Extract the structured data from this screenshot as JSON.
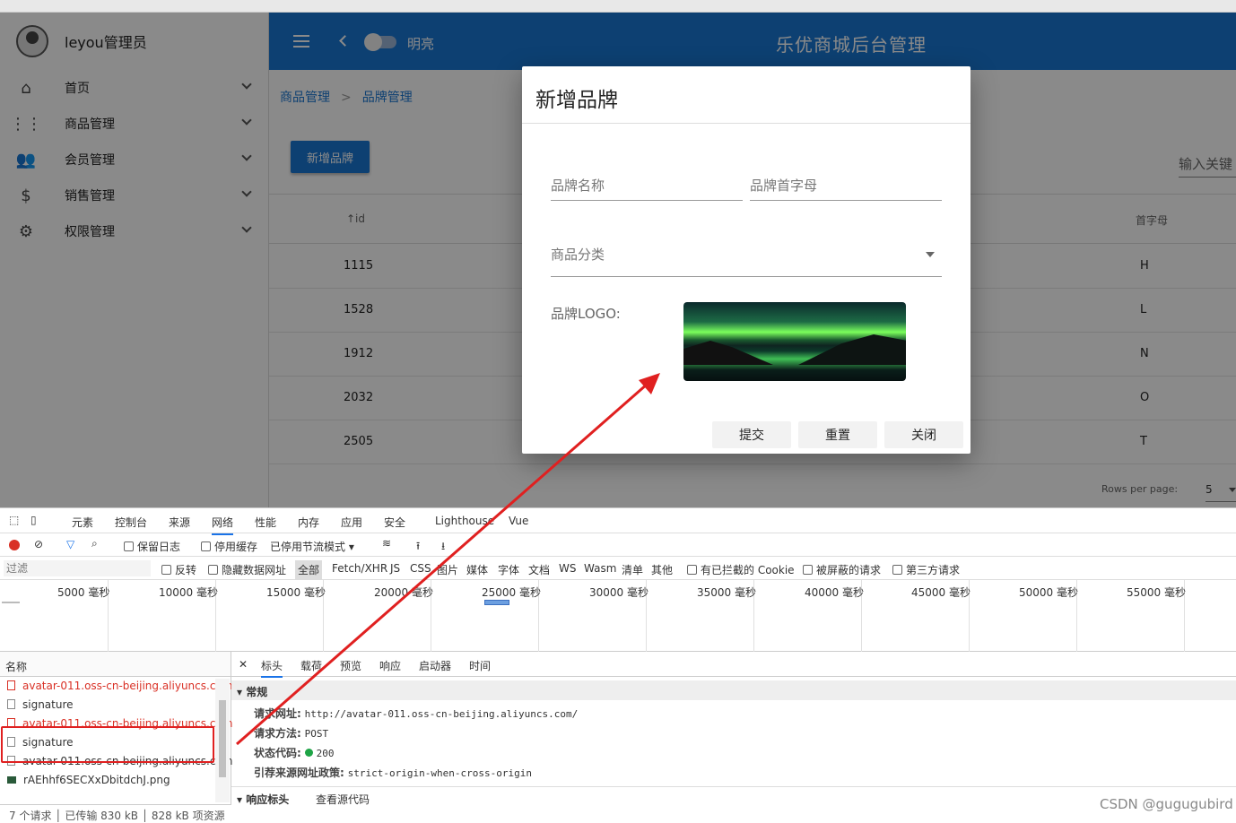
{
  "sidebar": {
    "user": "leyou管理员",
    "items": [
      {
        "label": "首页",
        "icon": "home-icon"
      },
      {
        "label": "商品管理",
        "icon": "apps-icon"
      },
      {
        "label": "会员管理",
        "icon": "people-icon"
      },
      {
        "label": "销售管理",
        "icon": "dollar-icon"
      },
      {
        "label": "权限管理",
        "icon": "gear-icon"
      }
    ]
  },
  "header": {
    "toggle_label": "明亮",
    "title": "乐优商城后台管理"
  },
  "breadcrumb": {
    "item1": "商品管理",
    "sep": ">",
    "item2": "品牌管理"
  },
  "main": {
    "add_button": "新增品牌",
    "search_placeholder": "输入关键",
    "col_id": "↑id",
    "col_letter": "首字母",
    "rows": [
      {
        "id": "1115",
        "letter": "H"
      },
      {
        "id": "1528",
        "letter": "L"
      },
      {
        "id": "1912",
        "letter": "N"
      },
      {
        "id": "2032",
        "letter": "O"
      },
      {
        "id": "2505",
        "letter": "T"
      }
    ],
    "rows_per_page_label": "Rows per page:",
    "rows_per_page_value": "5"
  },
  "dialog": {
    "title": "新增品牌",
    "name_placeholder": "品牌名称",
    "letter_placeholder": "品牌首字母",
    "category_placeholder": "商品分类",
    "logo_label": "品牌LOGO:",
    "submit": "提交",
    "reset": "重置",
    "close": "关闭"
  },
  "devtools": {
    "tabs": [
      "元素",
      "控制台",
      "来源",
      "网络",
      "性能",
      "内存",
      "应用",
      "安全",
      "Lighthouse",
      "Vue"
    ],
    "toolbar": {
      "preserve_log": "保留日志",
      "disable_cache": "停用缓存",
      "throttle": "已停用节流模式"
    },
    "filter": {
      "placeholder": "过滤",
      "invert": "反转",
      "hide_data": "隐藏数据网址",
      "types": [
        "全部",
        "Fetch/XHR",
        "JS",
        "CSS",
        "图片",
        "媒体",
        "字体",
        "文档",
        "WS",
        "Wasm",
        "清单",
        "其他"
      ],
      "blocked_cookies": "有已拦截的 Cookie",
      "blocked_requests": "被屏蔽的请求",
      "third_party": "第三方请求"
    },
    "timeline": [
      "5000 毫秒",
      "10000 毫秒",
      "15000 毫秒",
      "20000 毫秒",
      "25000 毫秒",
      "30000 毫秒",
      "35000 毫秒",
      "40000 毫秒",
      "45000 毫秒",
      "50000 毫秒",
      "55000 毫秒"
    ],
    "name_header": "名称",
    "requests": [
      {
        "name": "avatar-011.oss-cn-beijing.aliyuncs.com",
        "error": true
      },
      {
        "name": "signature",
        "error": false
      },
      {
        "name": "avatar-011.oss-cn-beijing.aliyuncs.com",
        "error": true
      },
      {
        "name": "signature",
        "error": false
      },
      {
        "name": "avatar-011.oss-cn-beijing.aliyuncs.com",
        "error": false
      },
      {
        "name": "rAEhhf6SECXxDbitdchJ.png",
        "error": false
      }
    ],
    "detail_tabs": [
      "标头",
      "载荷",
      "预览",
      "响应",
      "启动器",
      "时间"
    ],
    "general_section": "▾ 常规",
    "general": [
      {
        "key": "请求网址:",
        "value": "http://avatar-011.oss-cn-beijing.aliyuncs.com/"
      },
      {
        "key": "请求方法:",
        "value": "POST"
      },
      {
        "key": "状态代码:",
        "value": "200"
      },
      {
        "key": "引荐来源网址政策:",
        "value": "strict-origin-when-cross-origin"
      }
    ],
    "response_headers": "▾ 响应标头",
    "view_source": "查看源代码",
    "status_bar": {
      "requests": "7 个请求",
      "transferred": "已传输 830 kB",
      "resources": "828 kB 项资源"
    }
  },
  "watermark": "CSDN @gugugubird",
  "colors": {
    "primary": "#1976d2",
    "annotation": "#e02020"
  }
}
